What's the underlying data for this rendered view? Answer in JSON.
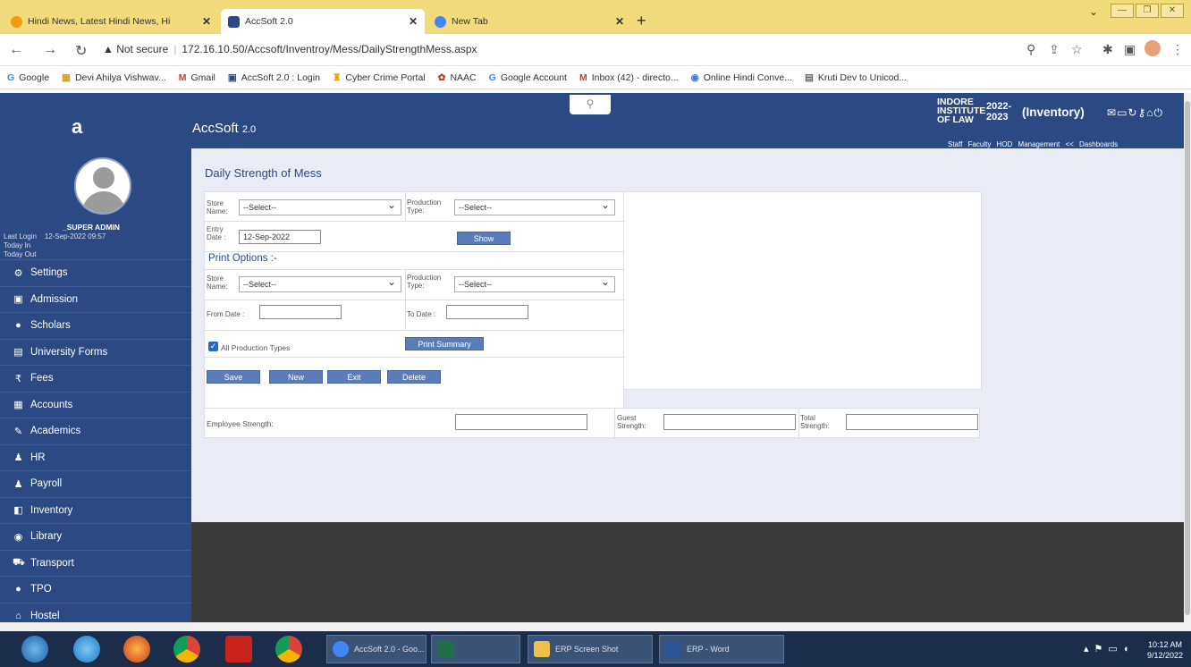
{
  "browser": {
    "tabs": [
      {
        "title": "Hindi News, Latest Hindi News, Hi",
        "active": false,
        "favicon_color": "#f39c12"
      },
      {
        "title": "AccSoft 2.0",
        "active": true,
        "favicon_color": "#2b4a84"
      },
      {
        "title": "New Tab",
        "active": false,
        "favicon_color": "#4285f4"
      }
    ],
    "new_tab_label": "+",
    "url_warning": "▲ Not secure",
    "url": "172.16.10.50/Accsoft/Inventroy/Mess/DailyStrengthMess.aspx",
    "bookmarks": [
      {
        "icon": "google-icon",
        "label": "Google"
      },
      {
        "icon": "devi-icon",
        "label": "Devi Ahilya Vishwav..."
      },
      {
        "icon": "gmail-icon",
        "label": "Gmail"
      },
      {
        "icon": "accsoft-icon",
        "label": "AccSoft 2.0 : Login"
      },
      {
        "icon": "cyber-icon",
        "label": "Cyber Crime Portal"
      },
      {
        "icon": "naac-icon",
        "label": "NAAC"
      },
      {
        "icon": "google-icon",
        "label": "Google Account"
      },
      {
        "icon": "gmail-icon",
        "label": "Inbox (42) - directo..."
      },
      {
        "icon": "hindi-icon",
        "label": "Online Hindi Conve..."
      },
      {
        "icon": "kruti-icon",
        "label": "Kruti Dev to Unicod..."
      }
    ]
  },
  "header": {
    "logo": "a",
    "app_name": "AccSoft",
    "app_version": "2.0",
    "institute_line1": "INDORE",
    "institute_line2": "INSTITUTE",
    "institute_line3": "OF LAW",
    "year_line1": "2022-",
    "year_line2": "2023",
    "module": "(Inventory)",
    "top_links": "Staff  Faculty  HOD  Management << Dashboards"
  },
  "sidebar": {
    "user_name": "_SUPER ADMIN",
    "last_login_label": "Last Login",
    "last_login_value": "12-Sep-2022 09:57",
    "today_in": "Today In",
    "today_out": "Today Out",
    "items": [
      {
        "label": "Settings",
        "icon": "gear-icon",
        "glyph": "⚙"
      },
      {
        "label": "Admission",
        "icon": "admission-icon",
        "glyph": "▣"
      },
      {
        "label": "Scholars",
        "icon": "user-icon",
        "glyph": "●"
      },
      {
        "label": "University Forms",
        "icon": "form-icon",
        "glyph": "▤"
      },
      {
        "label": "Fees",
        "icon": "rupee-icon",
        "glyph": "₹"
      },
      {
        "label": "Accounts",
        "icon": "accounts-icon",
        "glyph": "▦"
      },
      {
        "label": "Academics",
        "icon": "pencil-icon",
        "glyph": "✎"
      },
      {
        "label": "HR",
        "icon": "group-icon",
        "glyph": "♟"
      },
      {
        "label": "Payroll",
        "icon": "group-icon",
        "glyph": "♟"
      },
      {
        "label": "Inventory",
        "icon": "inventory-icon",
        "glyph": "◧"
      },
      {
        "label": "Library",
        "icon": "library-icon",
        "glyph": "◉"
      },
      {
        "label": "Transport",
        "icon": "car-icon",
        "glyph": "⛟"
      },
      {
        "label": "TPO",
        "icon": "user-icon",
        "glyph": "●"
      },
      {
        "label": "Hostel",
        "icon": "home-icon",
        "glyph": "⌂"
      }
    ]
  },
  "page": {
    "title": "Daily Strength of Mess",
    "store_name_label": "Store Name:",
    "production_type_label": "Production Type:",
    "store_select": "--Select--",
    "production_select": "--Select--",
    "entry_date_label": "Entry Date :",
    "entry_date_value": "12-Sep-2022",
    "show_button": "Show",
    "print_options": "Print Options :-",
    "print_store_label": "Store Name:",
    "print_production_label": "Production Type:",
    "print_store_select": "--Select--",
    "print_production_select": "--Select--",
    "from_date_label": "From Date :",
    "to_date_label": "To Date :",
    "all_production_label": "All Production Types",
    "print_summary_button": "Print Summary",
    "save_button": "Save",
    "new_button": "New",
    "exit_button": "Exit",
    "delete_button": "Delete",
    "employee_strength_label": "Employee Strength:",
    "guest_strength_label": "Guest Strength:",
    "total_strength_label": "Total Strength:"
  },
  "taskbar": {
    "windows": [
      {
        "label": "AccSoft 2.0 - Goo...",
        "icon": "chrome-icon",
        "color": "#4285f4"
      },
      {
        "label": "",
        "icon": "excel-icon",
        "color": "#1e7145"
      },
      {
        "label": "ERP Screen Shot",
        "icon": "folder-icon",
        "color": "#f0c04a"
      },
      {
        "label": "ERP - Word",
        "icon": "word-icon",
        "color": "#2b5797"
      }
    ],
    "time": "10:12 AM",
    "date": "9/12/2022"
  }
}
